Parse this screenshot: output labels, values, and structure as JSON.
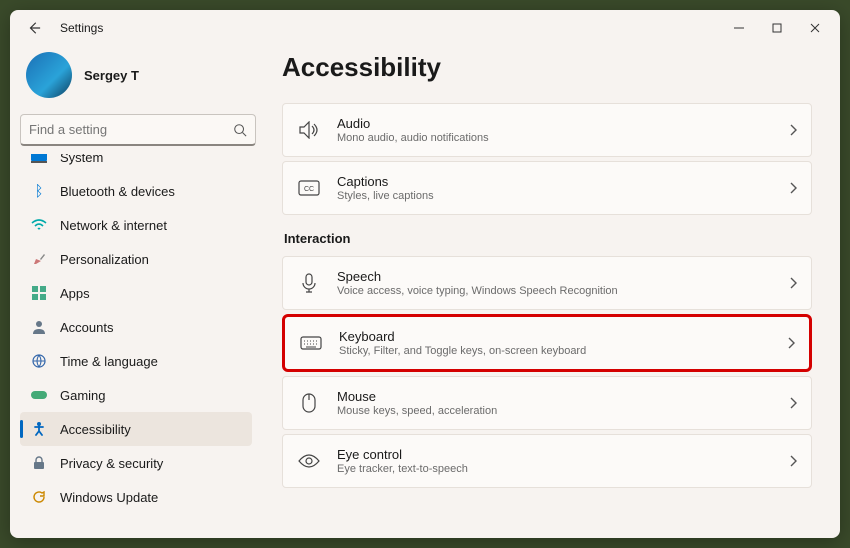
{
  "titlebar": {
    "title": "Settings"
  },
  "profile": {
    "name": "Sergey T"
  },
  "search": {
    "placeholder": "Find a setting"
  },
  "nav": {
    "items": [
      {
        "icon": "system",
        "label": "System"
      },
      {
        "icon": "bluetooth",
        "label": "Bluetooth & devices"
      },
      {
        "icon": "wifi",
        "label": "Network & internet"
      },
      {
        "icon": "brush",
        "label": "Personalization"
      },
      {
        "icon": "apps",
        "label": "Apps"
      },
      {
        "icon": "person",
        "label": "Accounts"
      },
      {
        "icon": "globe",
        "label": "Time & language"
      },
      {
        "icon": "game",
        "label": "Gaming"
      },
      {
        "icon": "a11y",
        "label": "Accessibility"
      },
      {
        "icon": "lock",
        "label": "Privacy & security"
      },
      {
        "icon": "update",
        "label": "Windows Update"
      }
    ]
  },
  "page": {
    "heading": "Accessibility",
    "section_interaction": "Interaction",
    "cards": {
      "audio": {
        "title": "Audio",
        "sub": "Mono audio, audio notifications"
      },
      "captions": {
        "title": "Captions",
        "sub": "Styles, live captions"
      },
      "speech": {
        "title": "Speech",
        "sub": "Voice access, voice typing, Windows Speech Recognition"
      },
      "keyboard": {
        "title": "Keyboard",
        "sub": "Sticky, Filter, and Toggle keys, on-screen keyboard"
      },
      "mouse": {
        "title": "Mouse",
        "sub": "Mouse keys, speed, acceleration"
      },
      "eye": {
        "title": "Eye control",
        "sub": "Eye tracker, text-to-speech"
      }
    }
  }
}
